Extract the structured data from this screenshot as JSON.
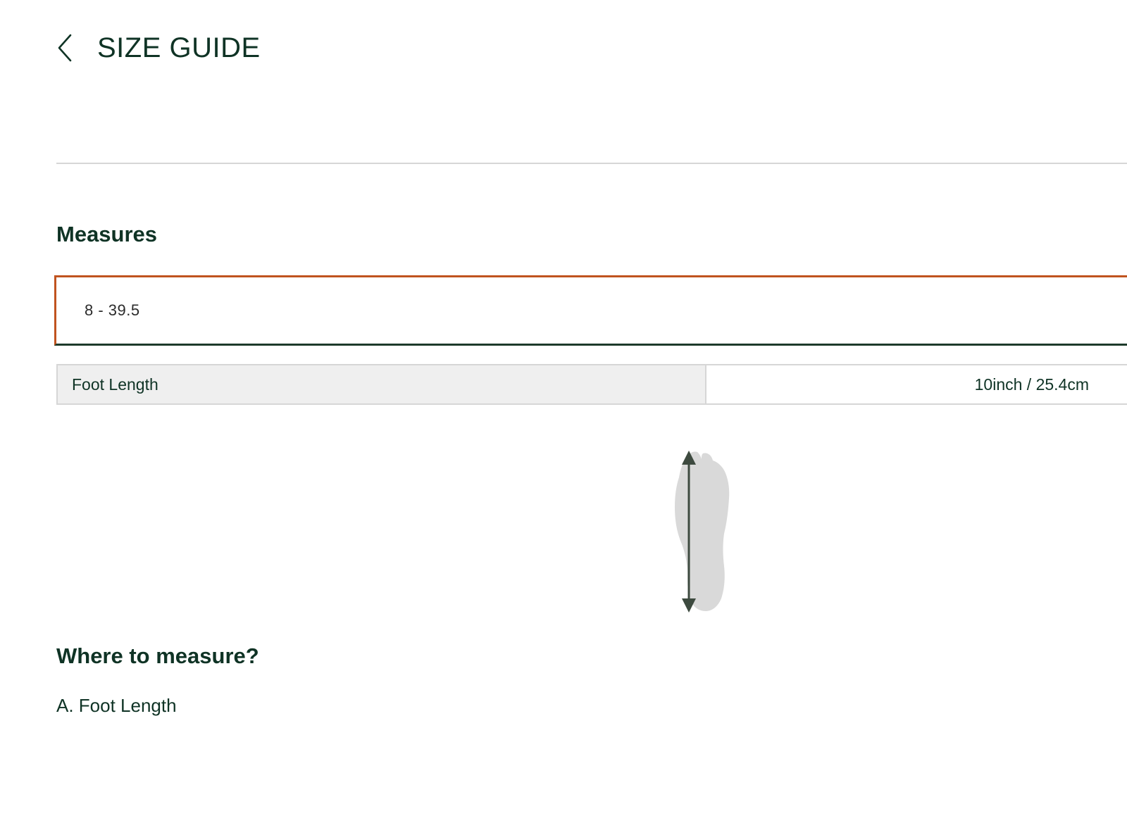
{
  "header": {
    "title": "SIZE GUIDE",
    "back_icon": "chevron-left-icon"
  },
  "measures": {
    "title": "Measures",
    "selected_size": "8 - 39.5",
    "rows": [
      {
        "label": "Foot Length",
        "value": "10inch / 25.4cm"
      }
    ]
  },
  "illustration": {
    "icon": "foot-length-diagram-icon"
  },
  "where": {
    "title": "Where to measure?",
    "items": [
      "A. Foot Length"
    ]
  },
  "colors": {
    "text": "#0f3325",
    "select_border": "#c0531f",
    "label_cell_bg": "#efefef",
    "divider": "#d6d6d6"
  }
}
